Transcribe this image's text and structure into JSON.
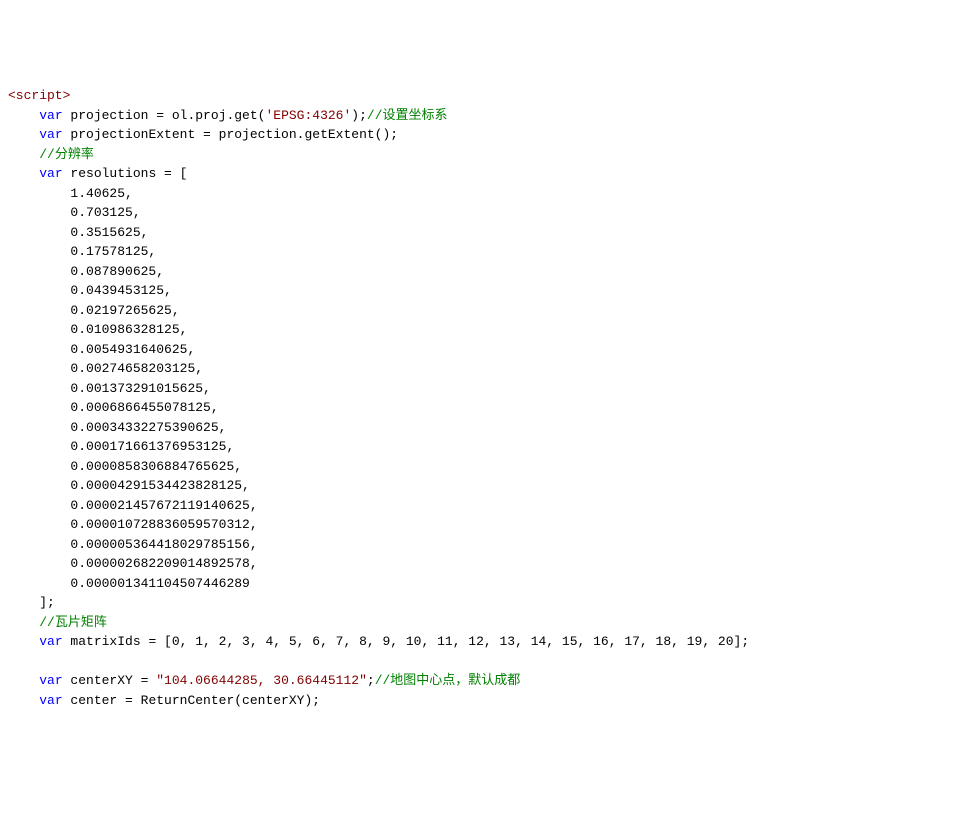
{
  "code": {
    "lines": [
      {
        "indent": 0,
        "tokens": [
          {
            "t": "<script>",
            "c": "tag"
          }
        ]
      },
      {
        "indent": 1,
        "tokens": [
          {
            "t": "var",
            "c": "kw"
          },
          {
            "t": " projection = ol.proj.get(",
            "c": "id"
          },
          {
            "t": "'EPSG:4326'",
            "c": "str"
          },
          {
            "t": ");",
            "c": "id"
          },
          {
            "t": "//设置坐标系",
            "c": "cm"
          }
        ]
      },
      {
        "indent": 1,
        "tokens": [
          {
            "t": "var",
            "c": "kw"
          },
          {
            "t": " projectionExtent = projection.getExtent();",
            "c": "id"
          }
        ]
      },
      {
        "indent": 1,
        "tokens": [
          {
            "t": "//分辨率",
            "c": "cm"
          }
        ]
      },
      {
        "indent": 1,
        "tokens": [
          {
            "t": "var",
            "c": "kw"
          },
          {
            "t": " resolutions = [",
            "c": "id"
          }
        ]
      },
      {
        "indent": 2,
        "tokens": [
          {
            "t": "1.40625,",
            "c": "num"
          }
        ]
      },
      {
        "indent": 2,
        "tokens": [
          {
            "t": "0.703125,",
            "c": "num"
          }
        ]
      },
      {
        "indent": 2,
        "tokens": [
          {
            "t": "0.3515625,",
            "c": "num"
          }
        ]
      },
      {
        "indent": 2,
        "tokens": [
          {
            "t": "0.17578125,",
            "c": "num"
          }
        ]
      },
      {
        "indent": 2,
        "tokens": [
          {
            "t": "0.087890625,",
            "c": "num"
          }
        ]
      },
      {
        "indent": 2,
        "tokens": [
          {
            "t": "0.0439453125,",
            "c": "num"
          }
        ]
      },
      {
        "indent": 2,
        "tokens": [
          {
            "t": "0.02197265625,",
            "c": "num"
          }
        ]
      },
      {
        "indent": 2,
        "tokens": [
          {
            "t": "0.010986328125,",
            "c": "num"
          }
        ]
      },
      {
        "indent": 2,
        "tokens": [
          {
            "t": "0.0054931640625,",
            "c": "num"
          }
        ]
      },
      {
        "indent": 2,
        "tokens": [
          {
            "t": "0.00274658203125,",
            "c": "num"
          }
        ]
      },
      {
        "indent": 2,
        "tokens": [
          {
            "t": "0.001373291015625,",
            "c": "num"
          }
        ]
      },
      {
        "indent": 2,
        "tokens": [
          {
            "t": "0.0006866455078125,",
            "c": "num"
          }
        ]
      },
      {
        "indent": 2,
        "tokens": [
          {
            "t": "0.00034332275390625,",
            "c": "num"
          }
        ]
      },
      {
        "indent": 2,
        "tokens": [
          {
            "t": "0.000171661376953125,",
            "c": "num"
          }
        ]
      },
      {
        "indent": 2,
        "tokens": [
          {
            "t": "0.0000858306884765625,",
            "c": "num"
          }
        ]
      },
      {
        "indent": 2,
        "tokens": [
          {
            "t": "0.00004291534423828125,",
            "c": "num"
          }
        ]
      },
      {
        "indent": 2,
        "tokens": [
          {
            "t": "0.000021457672119140625,",
            "c": "num"
          }
        ]
      },
      {
        "indent": 2,
        "tokens": [
          {
            "t": "0.000010728836059570312,",
            "c": "num"
          }
        ]
      },
      {
        "indent": 2,
        "tokens": [
          {
            "t": "0.000005364418029785156,",
            "c": "num"
          }
        ]
      },
      {
        "indent": 2,
        "tokens": [
          {
            "t": "0.000002682209014892578,",
            "c": "num"
          }
        ]
      },
      {
        "indent": 2,
        "tokens": [
          {
            "t": "0.000001341104507446289",
            "c": "num"
          }
        ]
      },
      {
        "indent": 1,
        "tokens": [
          {
            "t": "];",
            "c": "id"
          }
        ]
      },
      {
        "indent": 1,
        "tokens": [
          {
            "t": "//瓦片矩阵",
            "c": "cm"
          }
        ]
      },
      {
        "indent": 1,
        "tokens": [
          {
            "t": "var",
            "c": "kw"
          },
          {
            "t": " matrixIds = [0, 1, 2, 3, 4, 5, 6, 7, 8, 9, 10, 11, 12, 13, 14, 15, 16, 17, 18, 19, 20];",
            "c": "id"
          }
        ]
      },
      {
        "indent": 1,
        "tokens": [
          {
            "t": "",
            "c": "id"
          }
        ]
      },
      {
        "indent": 1,
        "tokens": [
          {
            "t": "var",
            "c": "kw"
          },
          {
            "t": " centerXY = ",
            "c": "id"
          },
          {
            "t": "\"104.06644285, 30.66445112\"",
            "c": "str"
          },
          {
            "t": ";",
            "c": "id"
          },
          {
            "t": "//地图中心点，默认成都",
            "c": "cm"
          }
        ]
      },
      {
        "indent": 1,
        "tokens": [
          {
            "t": "var",
            "c": "kw"
          },
          {
            "t": " center = ReturnCenter(centerXY);",
            "c": "id"
          }
        ]
      }
    ]
  }
}
